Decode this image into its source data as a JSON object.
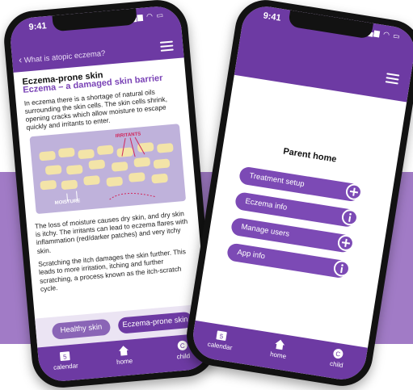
{
  "left_phone": {
    "status_time": "9:41",
    "back_label": "What is atopic eczema?",
    "article": {
      "heading": "Eczema-prone skin",
      "subheading": "Eczema – a damaged skin barrier",
      "para1": "In eczema there is a shortage of natural oils surrounding the skin cells. The skin cells shrink, opening cracks which allow moisture to escape quickly and irritants to enter.",
      "diagram_irritants": "IRRITANTS",
      "diagram_moisture": "MOISTURE",
      "para2": "The loss of moisture causes dry skin, and dry skin is itchy. The irritants can lead to eczema flares with inflammation (red/darker patches) and very itchy skin.",
      "para3": "Scratching the itch damages the skin further. This leads to more irritation, itching and further scratching, a process known as the itch-scratch cycle."
    },
    "skin_tabs": [
      "Healthy skin",
      "Eczema-prone skin"
    ],
    "nav": {
      "calendar": "calendar",
      "calendar_day": "5",
      "home": "home",
      "child": "child",
      "child_letter": "C"
    }
  },
  "right_phone": {
    "status_time": "9:41",
    "title": "Parent home",
    "menu": [
      {
        "label": "Treatment setup",
        "icon": "plus-icon"
      },
      {
        "label": "Eczema info",
        "icon": "info-icon"
      },
      {
        "label": "Manage users",
        "icon": "plus-icon"
      },
      {
        "label": "App info",
        "icon": "info-icon"
      }
    ],
    "nav": {
      "calendar": "calendar",
      "calendar_day": "5",
      "home": "home",
      "child": "child",
      "child_letter": "C"
    }
  },
  "colors": {
    "brand_purple": "#6d3aa3",
    "button_purple": "#7c4ab5",
    "band_lavender": "#a17bc6",
    "heading_purple": "#7a43b6"
  }
}
